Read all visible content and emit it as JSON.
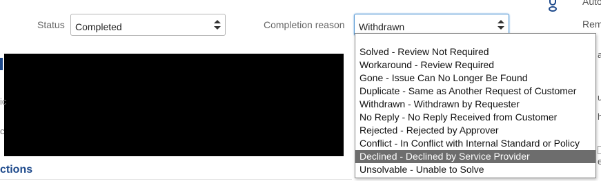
{
  "form": {
    "status_label": "Status",
    "status_value": "Completed",
    "reason_label": "Completion reason",
    "reason_value": "Withdrawn"
  },
  "dropdown": {
    "options": [
      "Solved - Review Not Required",
      "Workaround - Review Required",
      "Gone - Issue Can No Longer Be Found",
      "Duplicate - Same as Another Request of Customer",
      "Withdrawn - Withdrawn by Requester",
      "No Reply - No Reply Received from Customer",
      "Rejected - Rejected by Approver",
      "Conflict - In Conflict with Internal Standard or Policy",
      "Declined - Declined by Service Provider",
      "Unsolvable - Unable to Solve"
    ],
    "highlighted": "Declined - Declined by Service Provider"
  },
  "section": {
    "title_partial": "ctions"
  },
  "right_panel": {
    "text_1": "Auto",
    "text_2": "Rem",
    "glyph_1": "a",
    "glyph_2": "u",
    "glyph_3": "h",
    "glyph_4": "e"
  },
  "left_edge": {
    "glyph_1": "ic",
    "glyph_2": "c"
  },
  "icons": {
    "user": "user-icon",
    "select_arrows": "sort-arrows-icon"
  },
  "colors": {
    "accent": "#1e4a8c",
    "focus": "#5b9bd5",
    "highlight": "#6d6d6d"
  }
}
